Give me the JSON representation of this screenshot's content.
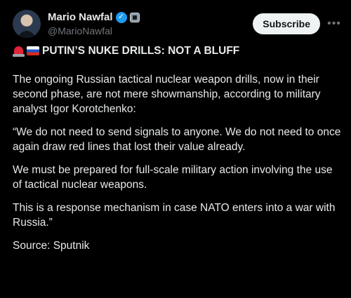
{
  "tweet": {
    "author": {
      "display_name": "Mario Nawfal",
      "handle": "@MarioNawfal"
    },
    "subscribe_label": "Subscribe",
    "more_icon": "•••",
    "headline": "PUTIN’S NUKE DRILLS: NOT A BLUFF",
    "headline_icons": [
      "siren-icon",
      "russia-flag-icon"
    ],
    "paragraphs": [
      "The ongoing Russian tactical nuclear weapon drills, now in their second phase, are not mere showmanship, according to military analyst Igor Korotchenko:",
      "“We do not need to send signals to anyone. We do not need to once again draw red lines that lost their value already.",
      "We must be prepared for full-scale military action involving the use of tactical nuclear weapons.",
      "This is a response mechanism in case NATO enters into a war with Russia.”",
      "Source: Sputnik"
    ]
  }
}
